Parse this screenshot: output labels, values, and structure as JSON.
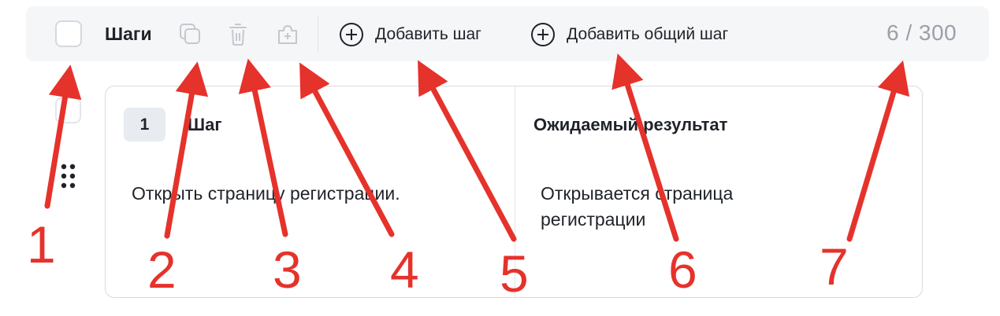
{
  "toolbar": {
    "title": "Шаги",
    "add_step_label": "Добавить шаг",
    "add_shared_step_label": "Добавить общий шаг",
    "counter": "6 / 300"
  },
  "step": {
    "number": "1",
    "step_header": "Шаг",
    "result_header": "Ожидаемый результат",
    "action_line": "Открыть страницу регистрации.",
    "result_lines": [
      "Открывается страница",
      "регистрации"
    ]
  },
  "annotations": [
    "1",
    "2",
    "3",
    "4",
    "5",
    "6",
    "7"
  ],
  "colors": {
    "annotation": "#e5322b",
    "toolbar_bg": "#f5f6f8",
    "badge_bg": "#e8ebef",
    "muted_text": "#9aa0a8"
  },
  "icons": {
    "checkbox": "checkbox-icon",
    "copy": "copy-icon",
    "delete": "trash-icon",
    "shared": "shared-step-icon",
    "add": "plus-circle-icon",
    "drag": "drag-handle-icon"
  }
}
